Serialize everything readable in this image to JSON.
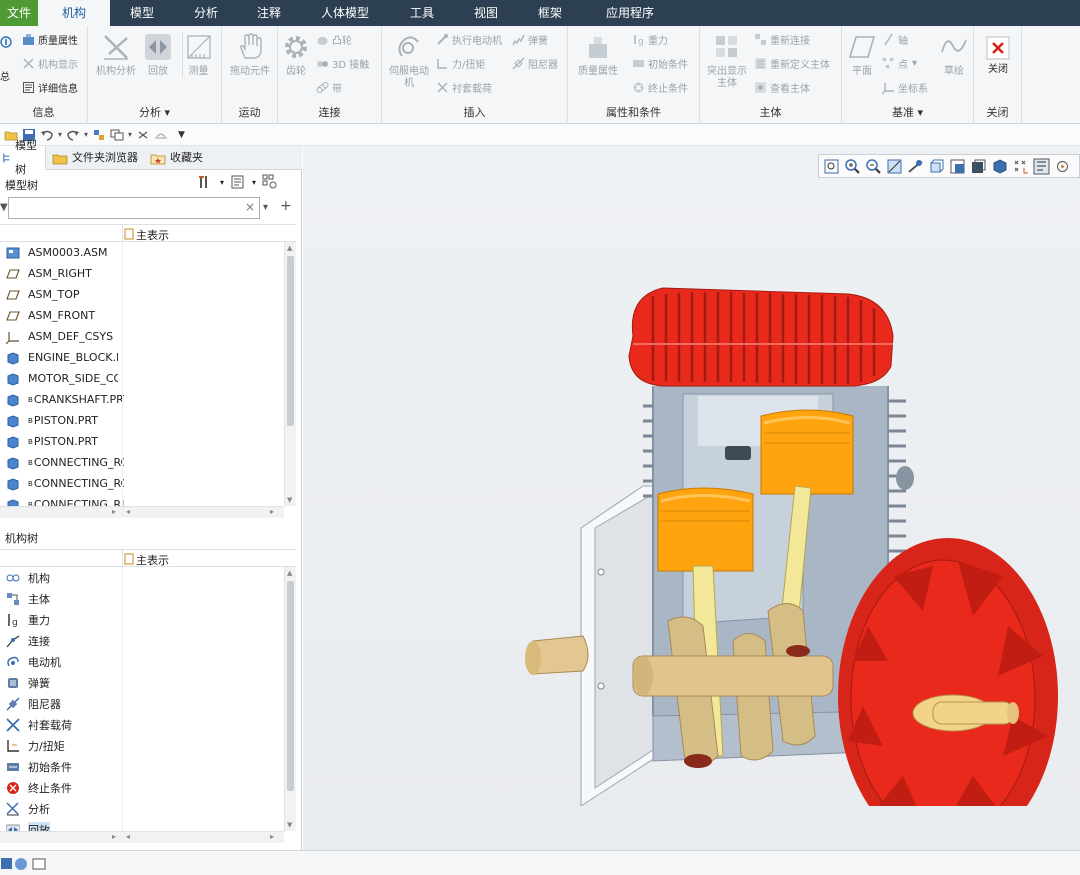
{
  "menu": {
    "tabs": [
      "文件",
      "机构",
      "模型",
      "分析",
      "注释",
      "人体模型",
      "工具",
      "视图",
      "框架",
      "应用程序"
    ]
  },
  "ribbon": {
    "info": {
      "label": "信息",
      "mass_props": "质量属性",
      "mech_display": "机构显示",
      "details": "详细信息",
      "sum_fragment": "总"
    },
    "analysis": {
      "label": "分析",
      "mech_analysis": "机构分析",
      "playback": "回放",
      "measure": "测量"
    },
    "motion": {
      "label": "运动",
      "drag": "拖动元件"
    },
    "connect": {
      "label": "连接",
      "gear": "齿轮",
      "cam": "凸轮",
      "contact3d": "3D 接触",
      "belt": "带"
    },
    "insert": {
      "label": "插入",
      "servo": "伺服电动机",
      "run_motor": "执行电动机",
      "force": "力/扭矩",
      "bushing": "衬套载荷",
      "spring": "弹簧",
      "damper": "阻尼器"
    },
    "props": {
      "label": "属性和条件",
      "mass_props": "质量属性",
      "gravity": "重力",
      "initial": "初始条件",
      "termination": "终止条件"
    },
    "body": {
      "label": "主体",
      "highlight": "突出显示主体",
      "reconnect": "重新连接",
      "redefine": "重新定义主体",
      "view_body": "查看主体"
    },
    "datum": {
      "label": "基准",
      "plane": "平面",
      "axis": "轴",
      "point": "点",
      "csys": "坐标系",
      "sketch": "草绘"
    },
    "close": {
      "label": "关闭",
      "close_btn": "关闭"
    }
  },
  "panel": {
    "tabs": [
      "模型树",
      "文件夹浏览器",
      "收藏夹"
    ],
    "model_tree_title": "模型树",
    "column_header": "主表示",
    "model_tree": [
      {
        "label": "ASM0003.ASM",
        "icon": "assembly-icon"
      },
      {
        "label": "ASM_RIGHT",
        "icon": "datum-plane-icon"
      },
      {
        "label": "ASM_TOP",
        "icon": "datum-plane-icon"
      },
      {
        "label": "ASM_FRONT",
        "icon": "datum-plane-icon"
      },
      {
        "label": "ASM_DEF_CSYS",
        "icon": "csys-icon"
      },
      {
        "label": "ENGINE_BLOCK.PF",
        "icon": "part-icon"
      },
      {
        "label": "MOTOR_SIDE_COV",
        "icon": "part-icon"
      },
      {
        "label": "CRANKSHAFT.PRT",
        "icon": "part-icon"
      },
      {
        "label": "PISTON.PRT",
        "icon": "part-icon"
      },
      {
        "label": "PISTON.PRT",
        "icon": "part-icon"
      },
      {
        "label": "CONNECTING_RC",
        "icon": "part-icon"
      },
      {
        "label": "CONNECTING_RC",
        "icon": "part-icon"
      },
      {
        "label": "CONNECTING_RI",
        "icon": "part-icon"
      }
    ],
    "part_prefix": "B",
    "mech_tree_title": "机构树",
    "mech_tree": [
      {
        "label": "机构",
        "icon": "mechanism-icon"
      },
      {
        "label": "主体",
        "icon": "body-icon"
      },
      {
        "label": "重力",
        "icon": "gravity-icon"
      },
      {
        "label": "连接",
        "icon": "connection-icon"
      },
      {
        "label": "电动机",
        "icon": "motor-icon"
      },
      {
        "label": "弹簧",
        "icon": "spring-icon"
      },
      {
        "label": "阻尼器",
        "icon": "damper-icon"
      },
      {
        "label": "衬套载荷",
        "icon": "bushing-icon"
      },
      {
        "label": "力/扭矩",
        "icon": "force-icon"
      },
      {
        "label": "初始条件",
        "icon": "initial-condition-icon"
      },
      {
        "label": "终止条件",
        "icon": "termination-icon"
      },
      {
        "label": "分析",
        "icon": "analysis-icon"
      },
      {
        "label": "回放",
        "icon": "playback-icon"
      }
    ]
  },
  "colors": {
    "menubar": "#2d3f52",
    "file_tab": "#4f9a34",
    "cylinder_head": "#e8291c",
    "piston": "#ffa30f",
    "connecting_rod": "#f3e79a",
    "crank": "#d5bd86",
    "block": "#a9b6c6",
    "flywheel": "#e8291c"
  }
}
